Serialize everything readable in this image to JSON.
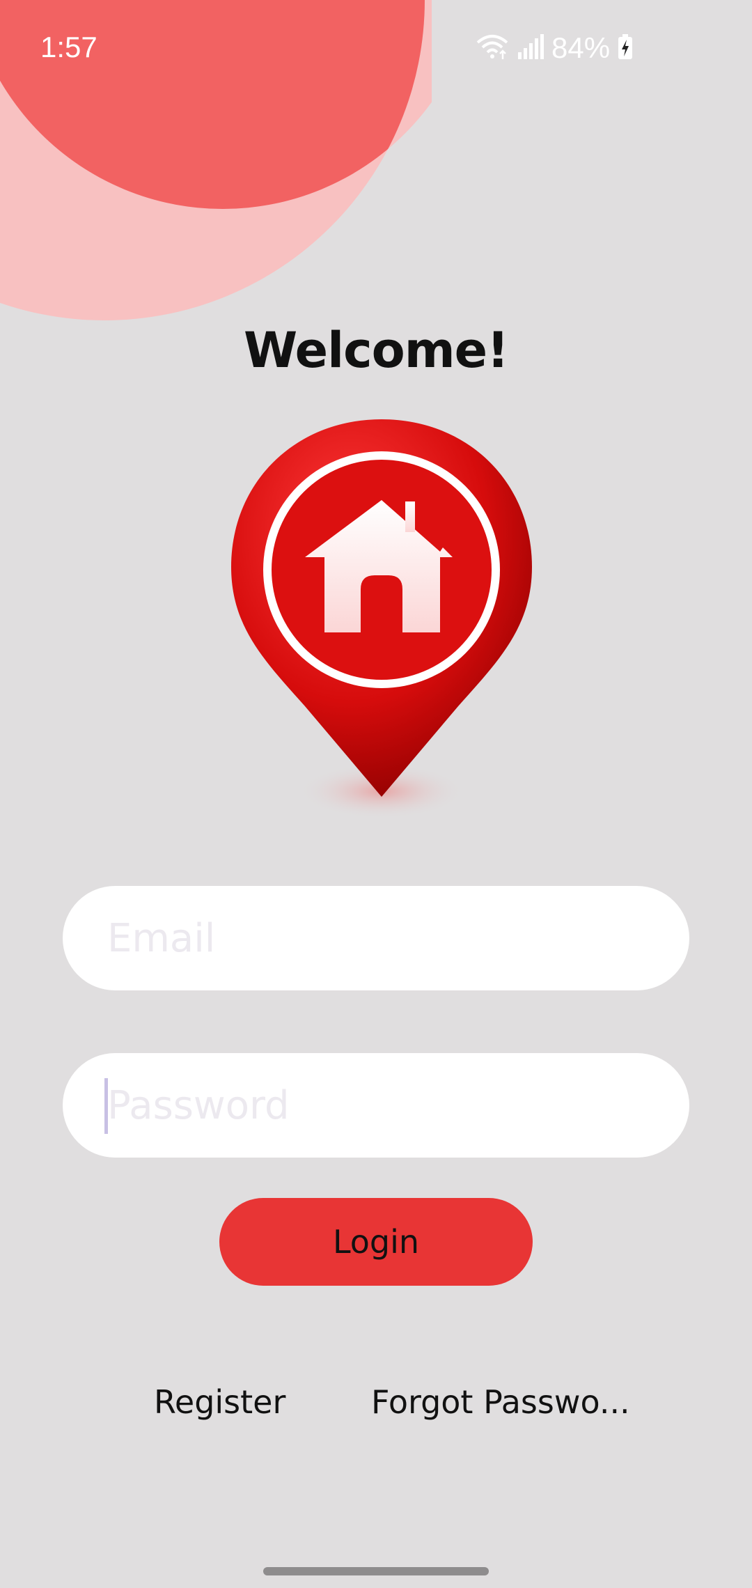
{
  "status_bar": {
    "time": "1:57",
    "battery_percent": "84%",
    "icons": [
      "wifi-icon",
      "signal-icon",
      "battery-charging-icon"
    ]
  },
  "header": {
    "title": "Welcome!"
  },
  "logo": {
    "icon": "home-location-pin-icon"
  },
  "form": {
    "email_placeholder": "Email",
    "email_value": "",
    "password_placeholder": "Password",
    "password_value": "",
    "login_label": "Login"
  },
  "links": {
    "register_label": "Register",
    "forgot_label": "Forgot Passwo..."
  },
  "colors": {
    "background": "#e0dedf",
    "accent": "#e83535",
    "deco_light": "#f8c1c1",
    "deco_dark": "#f26262"
  }
}
